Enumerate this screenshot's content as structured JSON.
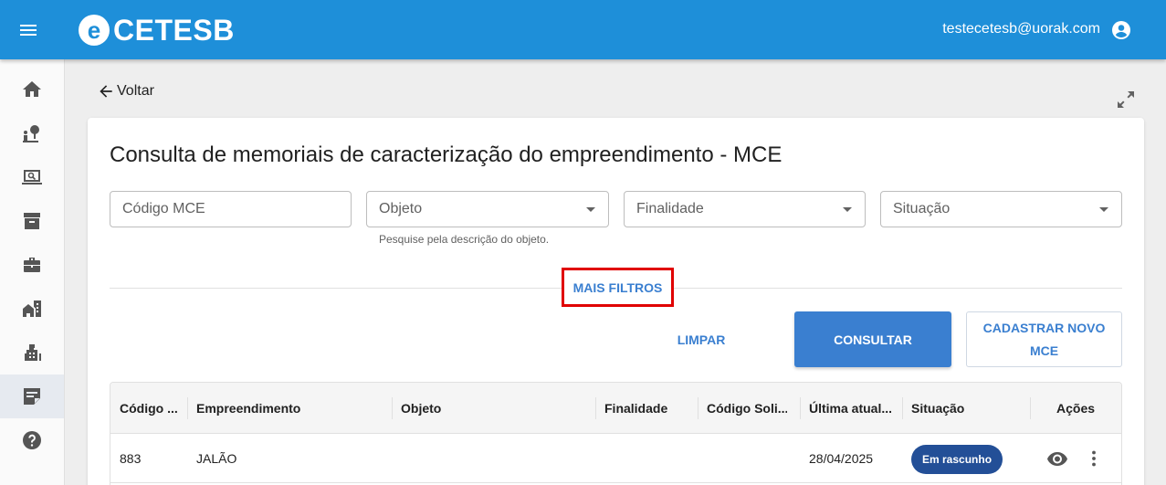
{
  "header": {
    "brand_letter": "e",
    "brand_name": "CETESB",
    "user_email": "testecetesb@uorak.com"
  },
  "colors": {
    "topbar": "#1e8fd9",
    "accent": "#3a7fd0",
    "badge": "#234f97",
    "highlight_border": "#e00000"
  },
  "sidebar": {
    "items": [
      {
        "icon": "home-icon"
      },
      {
        "icon": "person-location-icon"
      },
      {
        "icon": "laptop-search-icon"
      },
      {
        "icon": "archive-icon"
      },
      {
        "icon": "briefcase-icon"
      },
      {
        "icon": "house-building-icon"
      },
      {
        "icon": "city-icon"
      },
      {
        "icon": "edit-note-icon",
        "active": true
      },
      {
        "icon": "help-icon"
      }
    ]
  },
  "page": {
    "back_label": "Voltar",
    "title": "Consulta de memoriais de caracterização do empreendimento - MCE"
  },
  "filters": {
    "code_placeholder": "Código MCE",
    "object_label": "Objeto",
    "object_hint": "Pesquise pela descrição do objeto.",
    "purpose_label": "Finalidade",
    "status_label": "Situação",
    "more_filters": "MAIS FILTROS"
  },
  "actions": {
    "clear": "LIMPAR",
    "search": "CONSULTAR",
    "new": "CADASTRAR NOVO MCE"
  },
  "table": {
    "columns": [
      "Código ...",
      "Empreendimento",
      "Objeto",
      "Finalidade",
      "Código Soli...",
      "Última atual...",
      "Situação",
      "Ações"
    ],
    "rows": [
      {
        "code": "883",
        "enterprise": "JALÃO",
        "object": "",
        "purpose": "",
        "request_code": "",
        "last_update": "28/04/2025",
        "status": "Em rascunho"
      }
    ]
  }
}
